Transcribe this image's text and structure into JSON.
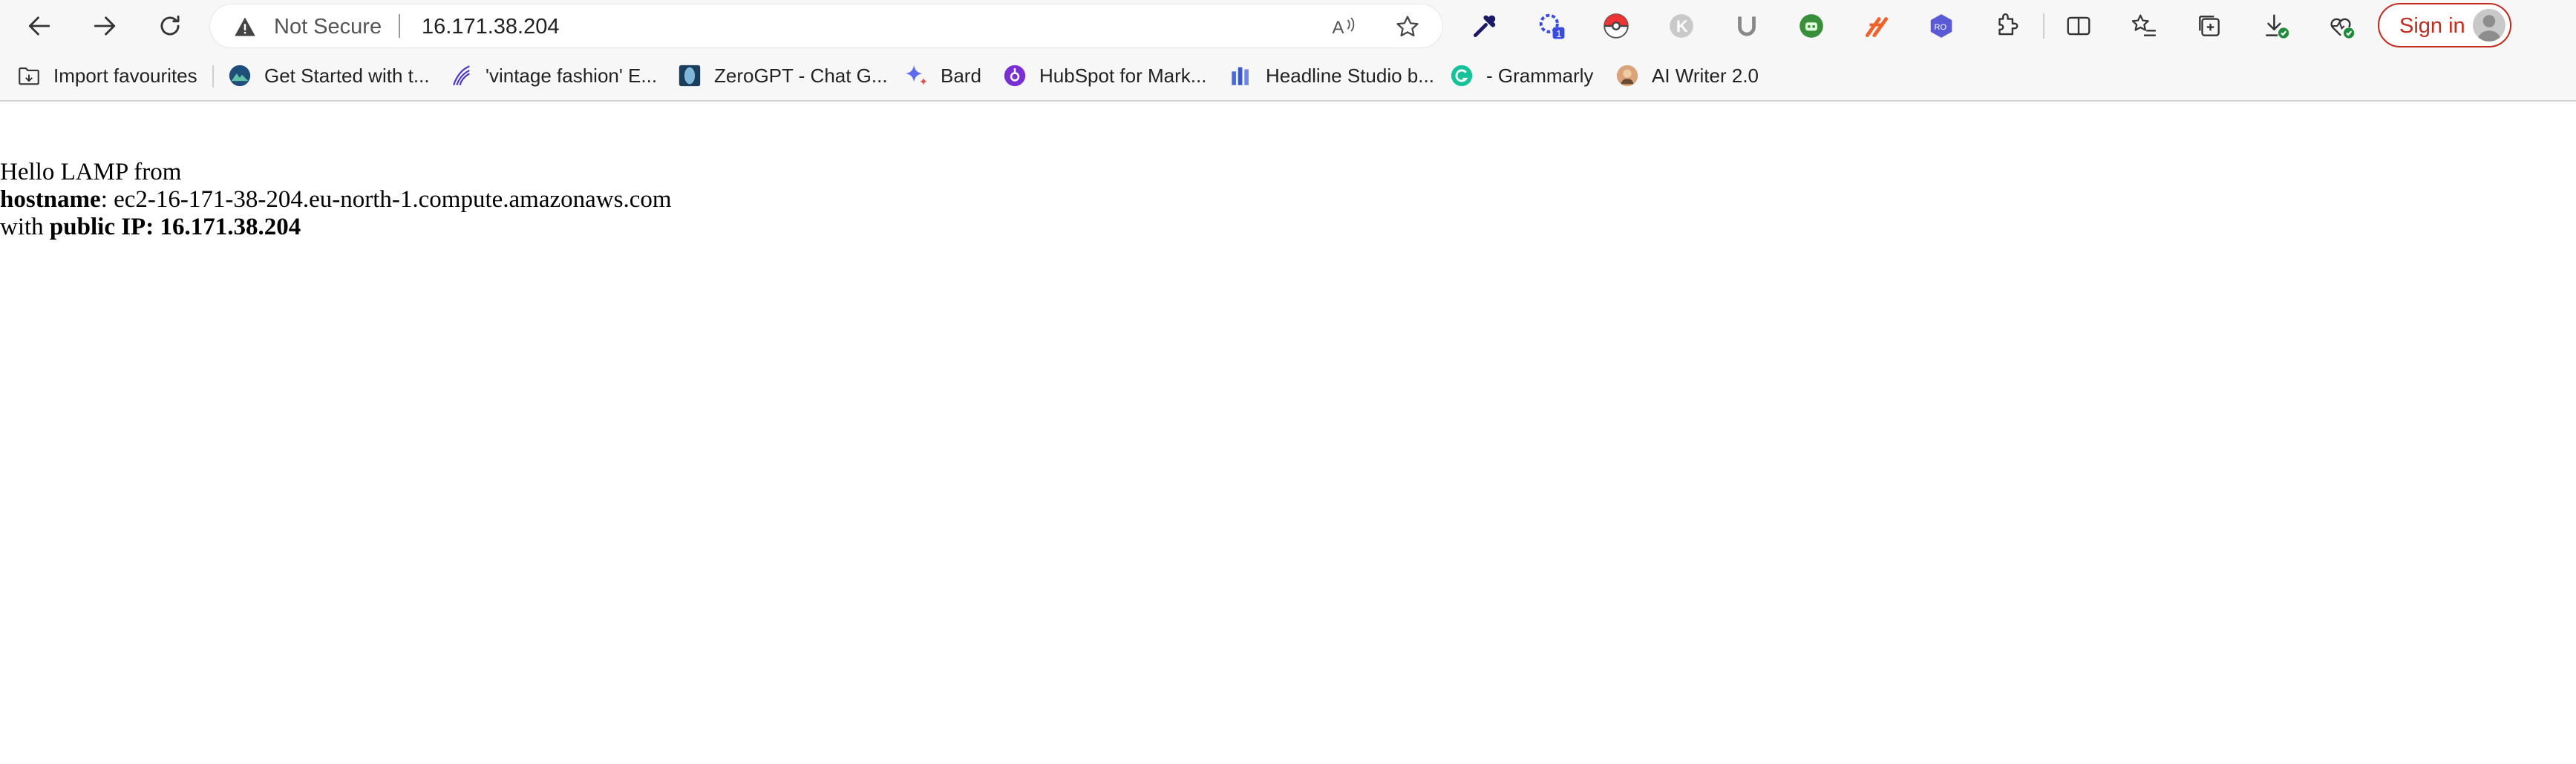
{
  "addressbar": {
    "security_label": "Not Secure",
    "url": "16.171.38.204"
  },
  "toolbar": {
    "signin_label": "Sign in",
    "extension_badge": "1"
  },
  "bookmarks": [
    {
      "label": "Import favourites",
      "icon": "import-favourites-icon"
    },
    {
      "label": "Get Started with t...",
      "icon": "mountain-logo-icon"
    },
    {
      "label": "'vintage fashion' E...",
      "icon": "feather-logo-icon"
    },
    {
      "label": "ZeroGPT - Chat G...",
      "icon": "zerogpt-logo-icon"
    },
    {
      "label": "Bard",
      "icon": "bard-sparkle-icon"
    },
    {
      "label": "HubSpot for Mark...",
      "icon": "hubspot-logo-icon"
    },
    {
      "label": "Headline Studio b...",
      "icon": "headline-studio-logo-icon"
    },
    {
      "label": "- Grammarly",
      "icon": "grammarly-logo-icon"
    },
    {
      "label": "AI Writer 2.0",
      "icon": "ai-writer-avatar-icon"
    }
  ],
  "page": {
    "line1": "Hello LAMP from",
    "hostname_label": "hostname",
    "hostname_value": ": ec2-16-171-38-204.eu-north-1.compute.amazonaws.com",
    "with_text": "with",
    "ip_label": "public IP: 16.171.38.204"
  },
  "colors": {
    "signin_accent": "#c42b1c",
    "chrome_background": "#f7f7f7"
  }
}
